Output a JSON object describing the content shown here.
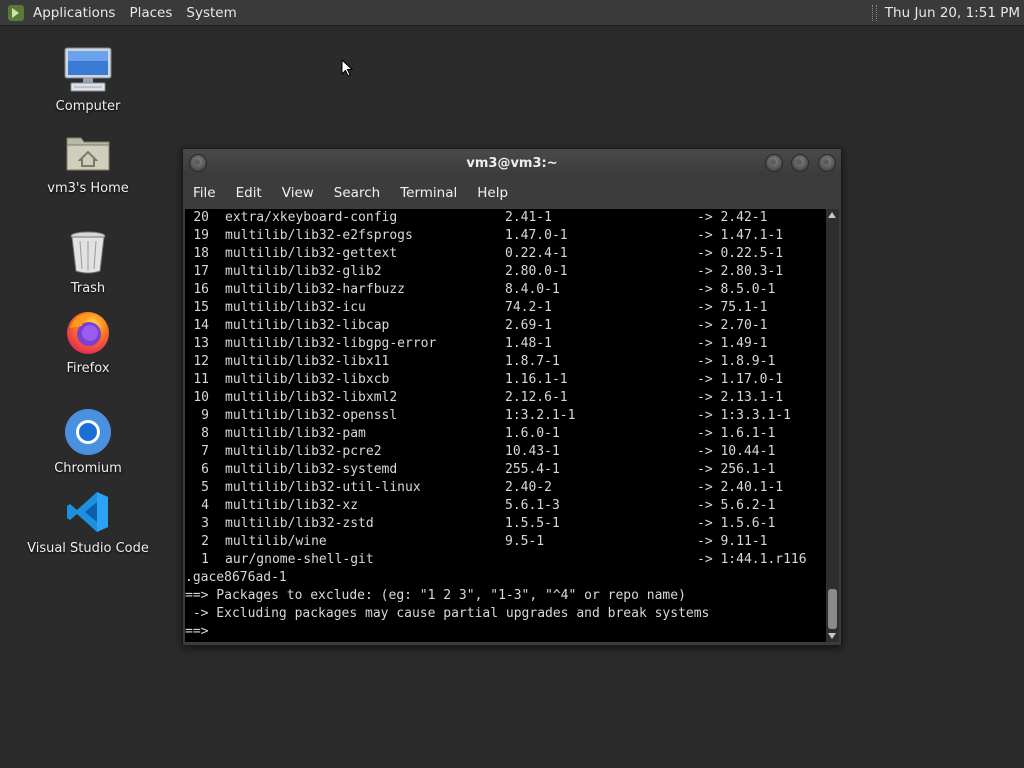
{
  "panel": {
    "menus": [
      "Applications",
      "Places",
      "System"
    ],
    "clock": "Thu Jun 20,  1:51 PM"
  },
  "desktop": {
    "icons": [
      {
        "label": "Computer",
        "icon": "computer-icon"
      },
      {
        "label": "vm3's Home",
        "icon": "home-folder-icon"
      },
      {
        "label": "Trash",
        "icon": "trash-icon"
      },
      {
        "label": "Firefox",
        "icon": "firefox-icon"
      },
      {
        "label": "Chromium",
        "icon": "chromium-icon"
      },
      {
        "label": "Visual Studio Code",
        "icon": "vscode-icon"
      }
    ]
  },
  "terminal": {
    "title": "vm3@vm3:~",
    "menu": [
      "File",
      "Edit",
      "View",
      "Search",
      "Terminal",
      "Help"
    ],
    "packages": [
      {
        "num": "20",
        "name": "extra/xkeyboard-config",
        "old": "2.41-1",
        "new": "-> 2.42-1"
      },
      {
        "num": "19",
        "name": "multilib/lib32-e2fsprogs",
        "old": "1.47.0-1",
        "new": "-> 1.47.1-1"
      },
      {
        "num": "18",
        "name": "multilib/lib32-gettext",
        "old": "0.22.4-1",
        "new": "-> 0.22.5-1"
      },
      {
        "num": "17",
        "name": "multilib/lib32-glib2",
        "old": "2.80.0-1",
        "new": "-> 2.80.3-1"
      },
      {
        "num": "16",
        "name": "multilib/lib32-harfbuzz",
        "old": "8.4.0-1",
        "new": "-> 8.5.0-1"
      },
      {
        "num": "15",
        "name": "multilib/lib32-icu",
        "old": "74.2-1",
        "new": "-> 75.1-1"
      },
      {
        "num": "14",
        "name": "multilib/lib32-libcap",
        "old": "2.69-1",
        "new": "-> 2.70-1"
      },
      {
        "num": "13",
        "name": "multilib/lib32-libgpg-error",
        "old": "1.48-1",
        "new": "-> 1.49-1"
      },
      {
        "num": "12",
        "name": "multilib/lib32-libx11",
        "old": "1.8.7-1",
        "new": "-> 1.8.9-1"
      },
      {
        "num": "11",
        "name": "multilib/lib32-libxcb",
        "old": "1.16.1-1",
        "new": "-> 1.17.0-1"
      },
      {
        "num": "10",
        "name": "multilib/lib32-libxml2",
        "old": "2.12.6-1",
        "new": "-> 2.13.1-1"
      },
      {
        "num": "9",
        "name": "multilib/lib32-openssl",
        "old": "1:3.2.1-1",
        "new": "-> 1:3.3.1-1"
      },
      {
        "num": "8",
        "name": "multilib/lib32-pam",
        "old": "1.6.0-1",
        "new": "-> 1.6.1-1"
      },
      {
        "num": "7",
        "name": "multilib/lib32-pcre2",
        "old": "10.43-1",
        "new": "-> 10.44-1"
      },
      {
        "num": "6",
        "name": "multilib/lib32-systemd",
        "old": "255.4-1",
        "new": "-> 256.1-1"
      },
      {
        "num": "5",
        "name": "multilib/lib32-util-linux",
        "old": "2.40-2",
        "new": "-> 2.40.1-1"
      },
      {
        "num": "4",
        "name": "multilib/lib32-xz",
        "old": "5.6.1-3",
        "new": "-> 5.6.2-1"
      },
      {
        "num": "3",
        "name": "multilib/lib32-zstd",
        "old": "1.5.5-1",
        "new": "-> 1.5.6-1"
      },
      {
        "num": "2",
        "name": "multilib/wine",
        "old": "9.5-1",
        "new": "-> 9.11-1"
      },
      {
        "num": "1",
        "name": "aur/gnome-shell-git",
        "old": "",
        "new": "-> 1:44.1.r116"
      }
    ],
    "wrap_line": ".gace8676ad-1",
    "prompt_line": "==> Packages to exclude: (eg: \"1 2 3\", \"1-3\", \"^4\" or repo name)",
    "warning_line": " -> Excluding packages may cause partial upgrades and break systems",
    "input_line": "==>"
  }
}
